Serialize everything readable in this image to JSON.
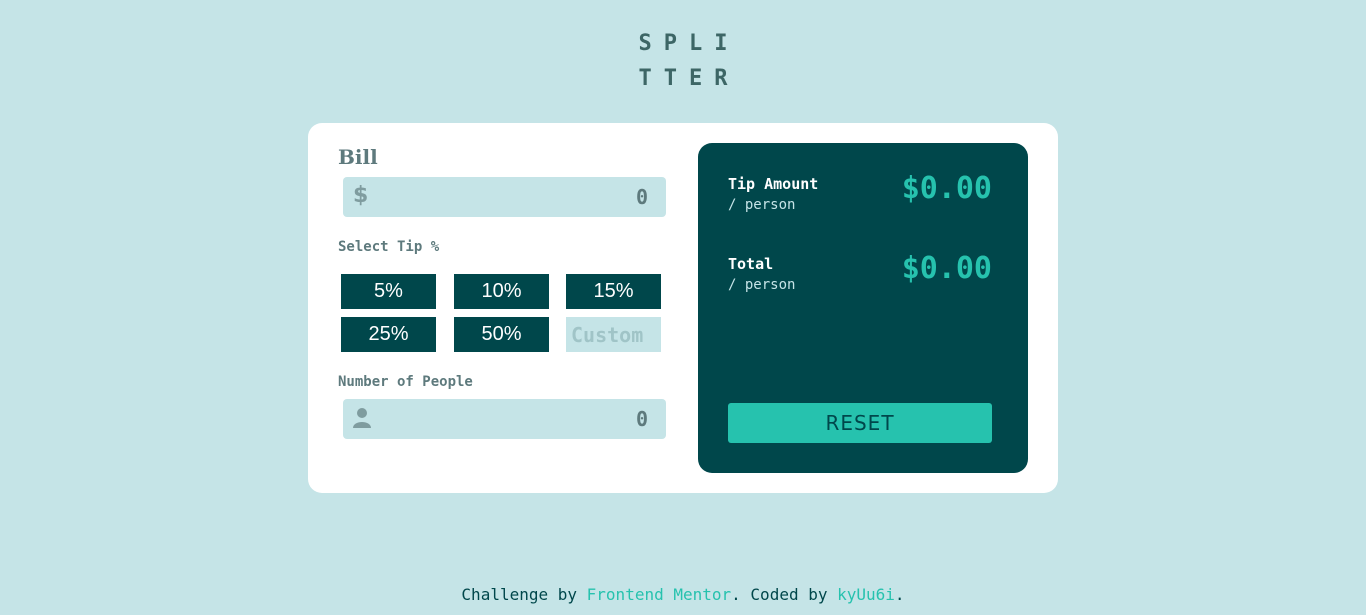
{
  "logo": {
    "line1": "SPLI",
    "line2": "TTER"
  },
  "bill": {
    "label": "Bill",
    "currency_icon": "$",
    "placeholder": "0"
  },
  "tip": {
    "label": "Select Tip %",
    "options": [
      "5%",
      "10%",
      "15%",
      "25%",
      "50%"
    ],
    "custom_placeholder": "Custom"
  },
  "people": {
    "label": "Number of People",
    "icon": "person-icon",
    "placeholder": "0"
  },
  "result": {
    "tip_label": "Tip Amount",
    "tip_sub": "/ person",
    "tip_value": "$0.00",
    "total_label": "Total",
    "total_sub": "/ person",
    "total_value": "$0.00",
    "reset_label": "RESET"
  },
  "footer": {
    "prefix": "Challenge by ",
    "link1": "Frontend Mentor",
    "middle": ". Coded by ",
    "link2": "kyUu6i",
    "suffix": "."
  },
  "colors": {
    "background": "#c5e4e7",
    "dark_cyan": "#00474b",
    "strong_cyan": "#26c2ae",
    "grayish_cyan": "#5e7a7d"
  }
}
